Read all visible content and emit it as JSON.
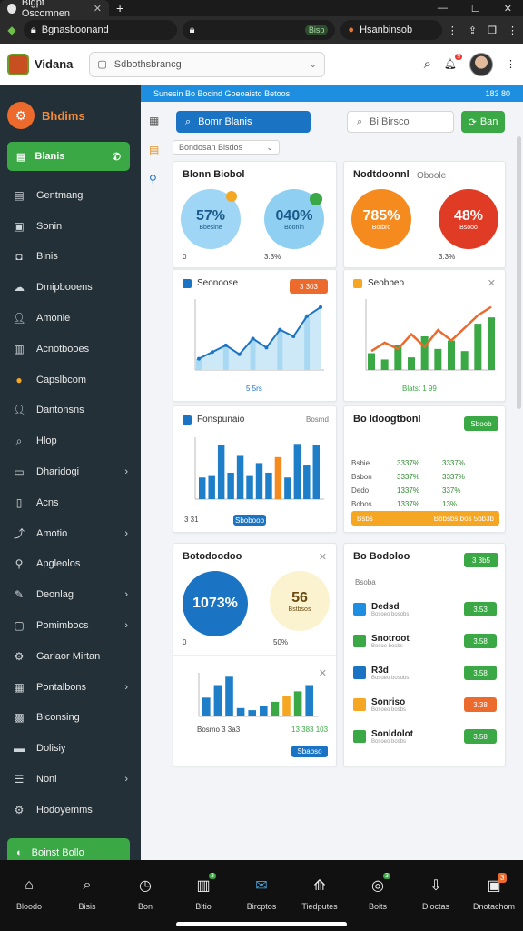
{
  "browser": {
    "tab_title": "Bigpt Oscomnen",
    "url1": "Bgnasboonand",
    "url1_pill": "Bisp",
    "url2": "Hsanbinsob"
  },
  "app": {
    "name": "Vidana",
    "search_value": "Sdbothsbrancg"
  },
  "sidebar": {
    "brand": "Bhdims",
    "active": "Blanis",
    "items": [
      {
        "label": "Gentmang",
        "icon": "doc-icon",
        "chev": ""
      },
      {
        "label": "Sonin",
        "icon": "calendar-icon",
        "chev": ""
      },
      {
        "label": "Binis",
        "icon": "chat-icon",
        "chev": ""
      },
      {
        "label": "Dmipbooens",
        "icon": "cloud-icon",
        "chev": ""
      },
      {
        "label": "Amonie",
        "icon": "user-icon",
        "chev": ""
      },
      {
        "label": "Acnotbooes",
        "icon": "folder-icon",
        "chev": ""
      },
      {
        "label": "Capslbcom",
        "icon": "coin-icon",
        "chev": ""
      },
      {
        "label": "Dantonsns",
        "icon": "person-icon",
        "chev": ""
      },
      {
        "label": "Hlop",
        "icon": "search-icon",
        "chev": ""
      },
      {
        "label": "Dharidogi",
        "icon": "monitor-icon",
        "chev": "›"
      },
      {
        "label": "Acns",
        "icon": "book-icon",
        "chev": ""
      },
      {
        "label": "Amotio",
        "icon": "chart-icon",
        "chev": "›"
      },
      {
        "label": "Apgleolos",
        "icon": "magnifier-icon",
        "chev": ""
      },
      {
        "label": "Deonlag",
        "icon": "tools-icon",
        "chev": "›"
      },
      {
        "label": "Pomimbocs",
        "icon": "tray-icon",
        "chev": "›"
      },
      {
        "label": "Garlaor Mirtan",
        "icon": "gear-icon",
        "chev": ""
      },
      {
        "label": "Pontalbons",
        "icon": "briefcase-icon",
        "chev": "›"
      },
      {
        "label": "Biconsing",
        "icon": "grid-icon",
        "chev": ""
      },
      {
        "label": "Dolisiy",
        "icon": "card-icon",
        "chev": ""
      },
      {
        "label": "Nonl",
        "icon": "list-icon",
        "chev": "›"
      },
      {
        "label": "Hodoyemms",
        "icon": "settings-icon",
        "chev": ""
      }
    ],
    "bottom": "Boinst Bollo"
  },
  "banner": {
    "left": "Sunesin Bo Bocind Goeoaisto Betoos",
    "right": "183 80"
  },
  "toolbar": {
    "primary": "Bomr Blanis",
    "search": "Bi Birsco",
    "green": "Ban",
    "select": "Bondosan Bisdos"
  },
  "cards": {
    "c1": {
      "title": "Blonn Biobol",
      "g1": "57%",
      "g1s": "Bbesine",
      "g2": "040%",
      "g2s": "Boonin",
      "foot_l": "0",
      "foot_r": "3.3%"
    },
    "c2": {
      "title": "Nodtdoonnl",
      "sub": "Oboole",
      "g1": "785%",
      "g1s": "Botbro",
      "g2": "48%",
      "g2s": "Bsooo",
      "foot_r": "3.3%"
    },
    "c3": {
      "title": "Seonoose",
      "tag": "3 303",
      "legend": "5 5rs"
    },
    "c4": {
      "title": "Seobbeo",
      "legend": "Blatst 1 99"
    },
    "c5": {
      "title": "Fonspunaio",
      "sub": "Bosmd",
      "foot_l": "3 31",
      "tag": "Sboboob"
    },
    "c6": {
      "title": "Bo Idoogtbonl",
      "tag": "Sboob",
      "rows": [
        {
          "a": "Bsbie",
          "b": "3337%",
          "c": "3337%"
        },
        {
          "a": "Bsbon",
          "b": "3337%",
          "c": "3337%"
        },
        {
          "a": "Dedo",
          "b": "1337%",
          "c": "337%"
        },
        {
          "a": "Bobos",
          "b": "1337%",
          "c": "13%"
        }
      ],
      "bar_l": "Bsbs",
      "bar_r": "Bbbsbs bos 5bb3b"
    },
    "c7": {
      "title": "Botodoodoo",
      "g1": "1073%",
      "g2": "56",
      "g2s": "Bstbsos",
      "foot_l": "0",
      "foot_r": "50%",
      "foot2_l": "Bosmo 3 3a3",
      "foot2_r": "13 383 103",
      "tag": "Sbabso"
    },
    "c8": {
      "title": "Bo Bodoloo",
      "sub": "Bsoba",
      "tag": "3 3b5",
      "rows": [
        {
          "t1": "Dedsd",
          "t2": "Bosoeo bosobs",
          "v": "3.53",
          "c": "#3aa845"
        },
        {
          "t1": "Snotroot",
          "t2": "Bosoe bosbs",
          "v": "3.58",
          "c": "#3aa845"
        },
        {
          "t1": "R3d",
          "t2": "Bosoeo bosobs",
          "v": "3.58",
          "c": "#3aa845"
        },
        {
          "t1": "Sonriso",
          "t2": "Bosoeo bosbs",
          "v": "3.38",
          "c": "#ec6a2c"
        },
        {
          "t1": "Sonldolot",
          "t2": "Bosoeo bosbs",
          "v": "3.58",
          "c": "#3aa845"
        }
      ]
    }
  },
  "bottomnav": [
    {
      "label": "Bloodo",
      "icon": "home-icon",
      "glyph": "⌂",
      "badge": ""
    },
    {
      "label": "Bisis",
      "icon": "search-icon",
      "glyph": "⌕",
      "badge": ""
    },
    {
      "label": "Bon",
      "icon": "clock-icon",
      "glyph": "◷",
      "badge": ""
    },
    {
      "label": "Bltio",
      "icon": "store-icon",
      "glyph": "▥",
      "badge": "3"
    },
    {
      "label": "Bircptos",
      "icon": "mail-icon",
      "glyph": "✉",
      "badge": ""
    },
    {
      "label": "Tiedputes",
      "icon": "stats-icon",
      "glyph": "⟰",
      "badge": ""
    },
    {
      "label": "Boits",
      "icon": "gauge-icon",
      "glyph": "◎",
      "badge": "3"
    },
    {
      "label": "Dloctas",
      "icon": "download-icon",
      "glyph": "⇩",
      "badge": ""
    },
    {
      "label": "Dnotachom",
      "icon": "chat-icon",
      "glyph": "▣",
      "badge": "3"
    }
  ],
  "chart_data": [
    {
      "type": "area",
      "title": "Seonoose",
      "values": [
        5,
        8,
        11,
        7,
        14,
        10,
        18,
        15,
        24,
        28
      ]
    },
    {
      "type": "line",
      "title": "Seobbeo",
      "series": [
        {
          "name": "bars",
          "values": [
            8,
            5,
            12,
            6,
            16,
            10,
            14,
            9,
            22,
            25
          ]
        },
        {
          "name": "line",
          "values": [
            9,
            13,
            10,
            17,
            11,
            19,
            14,
            20,
            26,
            30
          ]
        }
      ]
    },
    {
      "type": "bar",
      "title": "Fonspunaio",
      "values": [
        18,
        20,
        45,
        22,
        36,
        20,
        30,
        22,
        35,
        18,
        46,
        28,
        45
      ]
    },
    {
      "type": "bar",
      "title": "Botodoodoo",
      "values": [
        18,
        30,
        38,
        8,
        6,
        10,
        14,
        20,
        24,
        30
      ]
    }
  ],
  "colors": {
    "sidebar": "#243038",
    "green": "#3aa845",
    "blue": "#1b73c4",
    "orange": "#ec6a2c",
    "red": "#e03b24",
    "light_blue": "#8fd0f2"
  }
}
